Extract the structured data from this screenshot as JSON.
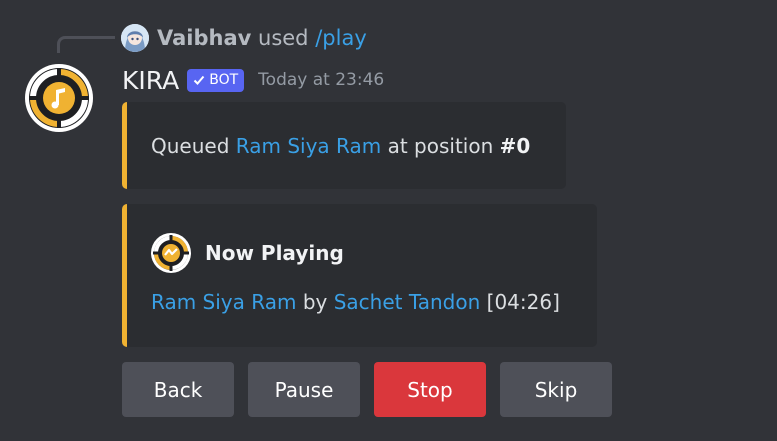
{
  "interaction": {
    "user": "Vaibhav",
    "used_text": "used",
    "command": "/play"
  },
  "message": {
    "author": "KIRA",
    "tag": "BOT",
    "timestamp": "Today at 23:46"
  },
  "embeds": [
    {
      "prefix": "Queued",
      "song": "Ram Siya Ram",
      "middle": "at position",
      "position": "#0"
    },
    {
      "author_name": "Now Playing",
      "song": "Ram Siya Ram",
      "by_text": "by",
      "artist": "Sachet Tandon",
      "duration": "[04:26]"
    }
  ],
  "buttons": [
    {
      "label": "Back",
      "style": "secondary"
    },
    {
      "label": "Pause",
      "style": "secondary"
    },
    {
      "label": "Stop",
      "style": "danger"
    },
    {
      "label": "Skip",
      "style": "secondary"
    }
  ],
  "icons": {
    "bot_avatar": "music-note-ring-icon",
    "embed_author": "loading-ring-icon",
    "bot_tag": "checkmark-icon"
  },
  "colors": {
    "background": "#313338",
    "embed_bg": "#2b2d31",
    "accent": "#f0b232",
    "link": "#3aa0e6",
    "blurple": "#5865f2",
    "danger": "#da373c",
    "secondary": "#4e5058"
  }
}
